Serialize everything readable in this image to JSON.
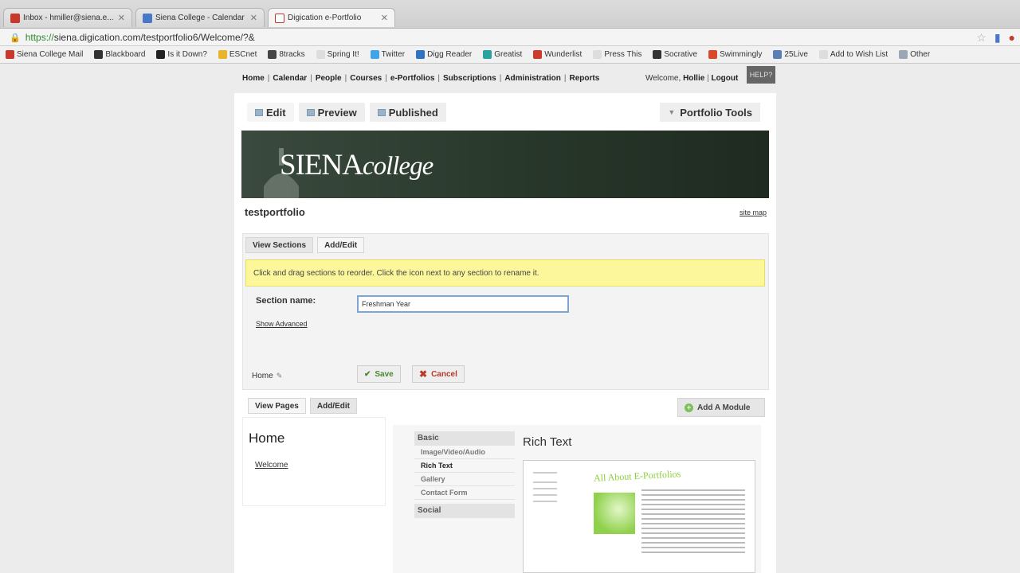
{
  "browser": {
    "tabs": [
      {
        "label": "Inbox - hmiller@siena.e...",
        "favicon_color": "#c9382b",
        "active": false
      },
      {
        "label": "Siena College - Calendar",
        "favicon_color": "#4a78c9",
        "active": false
      },
      {
        "label": "Digication e-Portfolio",
        "favicon_color": "#c0392b",
        "active": true
      }
    ],
    "url_secure": "https://",
    "url_rest": "siena.digication.com/testportfolio6/Welcome/?&",
    "bookmarks": [
      {
        "label": "Siena College Mail",
        "color": "#c9382b"
      },
      {
        "label": "Blackboard",
        "color": "#333333"
      },
      {
        "label": "Is it Down?",
        "color": "#222222"
      },
      {
        "label": "ESCnet",
        "color": "#e8b428"
      },
      {
        "label": "8tracks",
        "color": "#444444"
      },
      {
        "label": "Spring It!",
        "color": "#dddddd"
      },
      {
        "label": "Twitter",
        "color": "#3fa4e8"
      },
      {
        "label": "Digg Reader",
        "color": "#2e73c4"
      },
      {
        "label": "Greatist",
        "color": "#2aa3a0"
      },
      {
        "label": "Wunderlist",
        "color": "#cc3b2e"
      },
      {
        "label": "Press This",
        "color": "#dddddd"
      },
      {
        "label": "Socrative",
        "color": "#333333"
      },
      {
        "label": "Swimmingly",
        "color": "#d84a2a"
      },
      {
        "label": "25Live",
        "color": "#5a7fb5"
      },
      {
        "label": "Add to Wish List",
        "color": "#dddddd"
      },
      {
        "label": "Other",
        "color": "#9aa7b5"
      }
    ]
  },
  "topnav": {
    "items": [
      "Home",
      "Calendar",
      "People",
      "Courses",
      "e-Portfolios",
      "Subscriptions",
      "Administration",
      "Reports"
    ],
    "welcome_prefix": "Welcome,",
    "user": "Hollie",
    "logout": "Logout",
    "help": "HELP?"
  },
  "editor": {
    "tabs": [
      "Edit",
      "Preview",
      "Published"
    ],
    "tools_label": "Portfolio Tools",
    "banner_brand": "SIENA",
    "banner_brand_italic": "college",
    "portfolio_title": "testportfolio",
    "site_map": "site map"
  },
  "sections": {
    "tabs": [
      "View Sections",
      "Add/Edit"
    ],
    "notice": "Click and drag sections to reorder. Click the icon next to any section to rename it.",
    "name_label": "Section name:",
    "name_value": "Freshman Year",
    "show_advanced": "Show Advanced",
    "save": "Save",
    "cancel": "Cancel",
    "crumb": "Home"
  },
  "pages": {
    "tabs": [
      "View Pages",
      "Add/Edit"
    ],
    "add_module": "Add A Module",
    "title": "Home",
    "item": "Welcome"
  },
  "modules": {
    "group_basic": "Basic",
    "items": [
      "Image/Video/Audio",
      "Rich Text",
      "Gallery",
      "Contact Form"
    ],
    "selected": "Rich Text",
    "group_social": "Social",
    "preview_title": "Rich Text",
    "preview_heading": "All About E-Portfolios"
  }
}
